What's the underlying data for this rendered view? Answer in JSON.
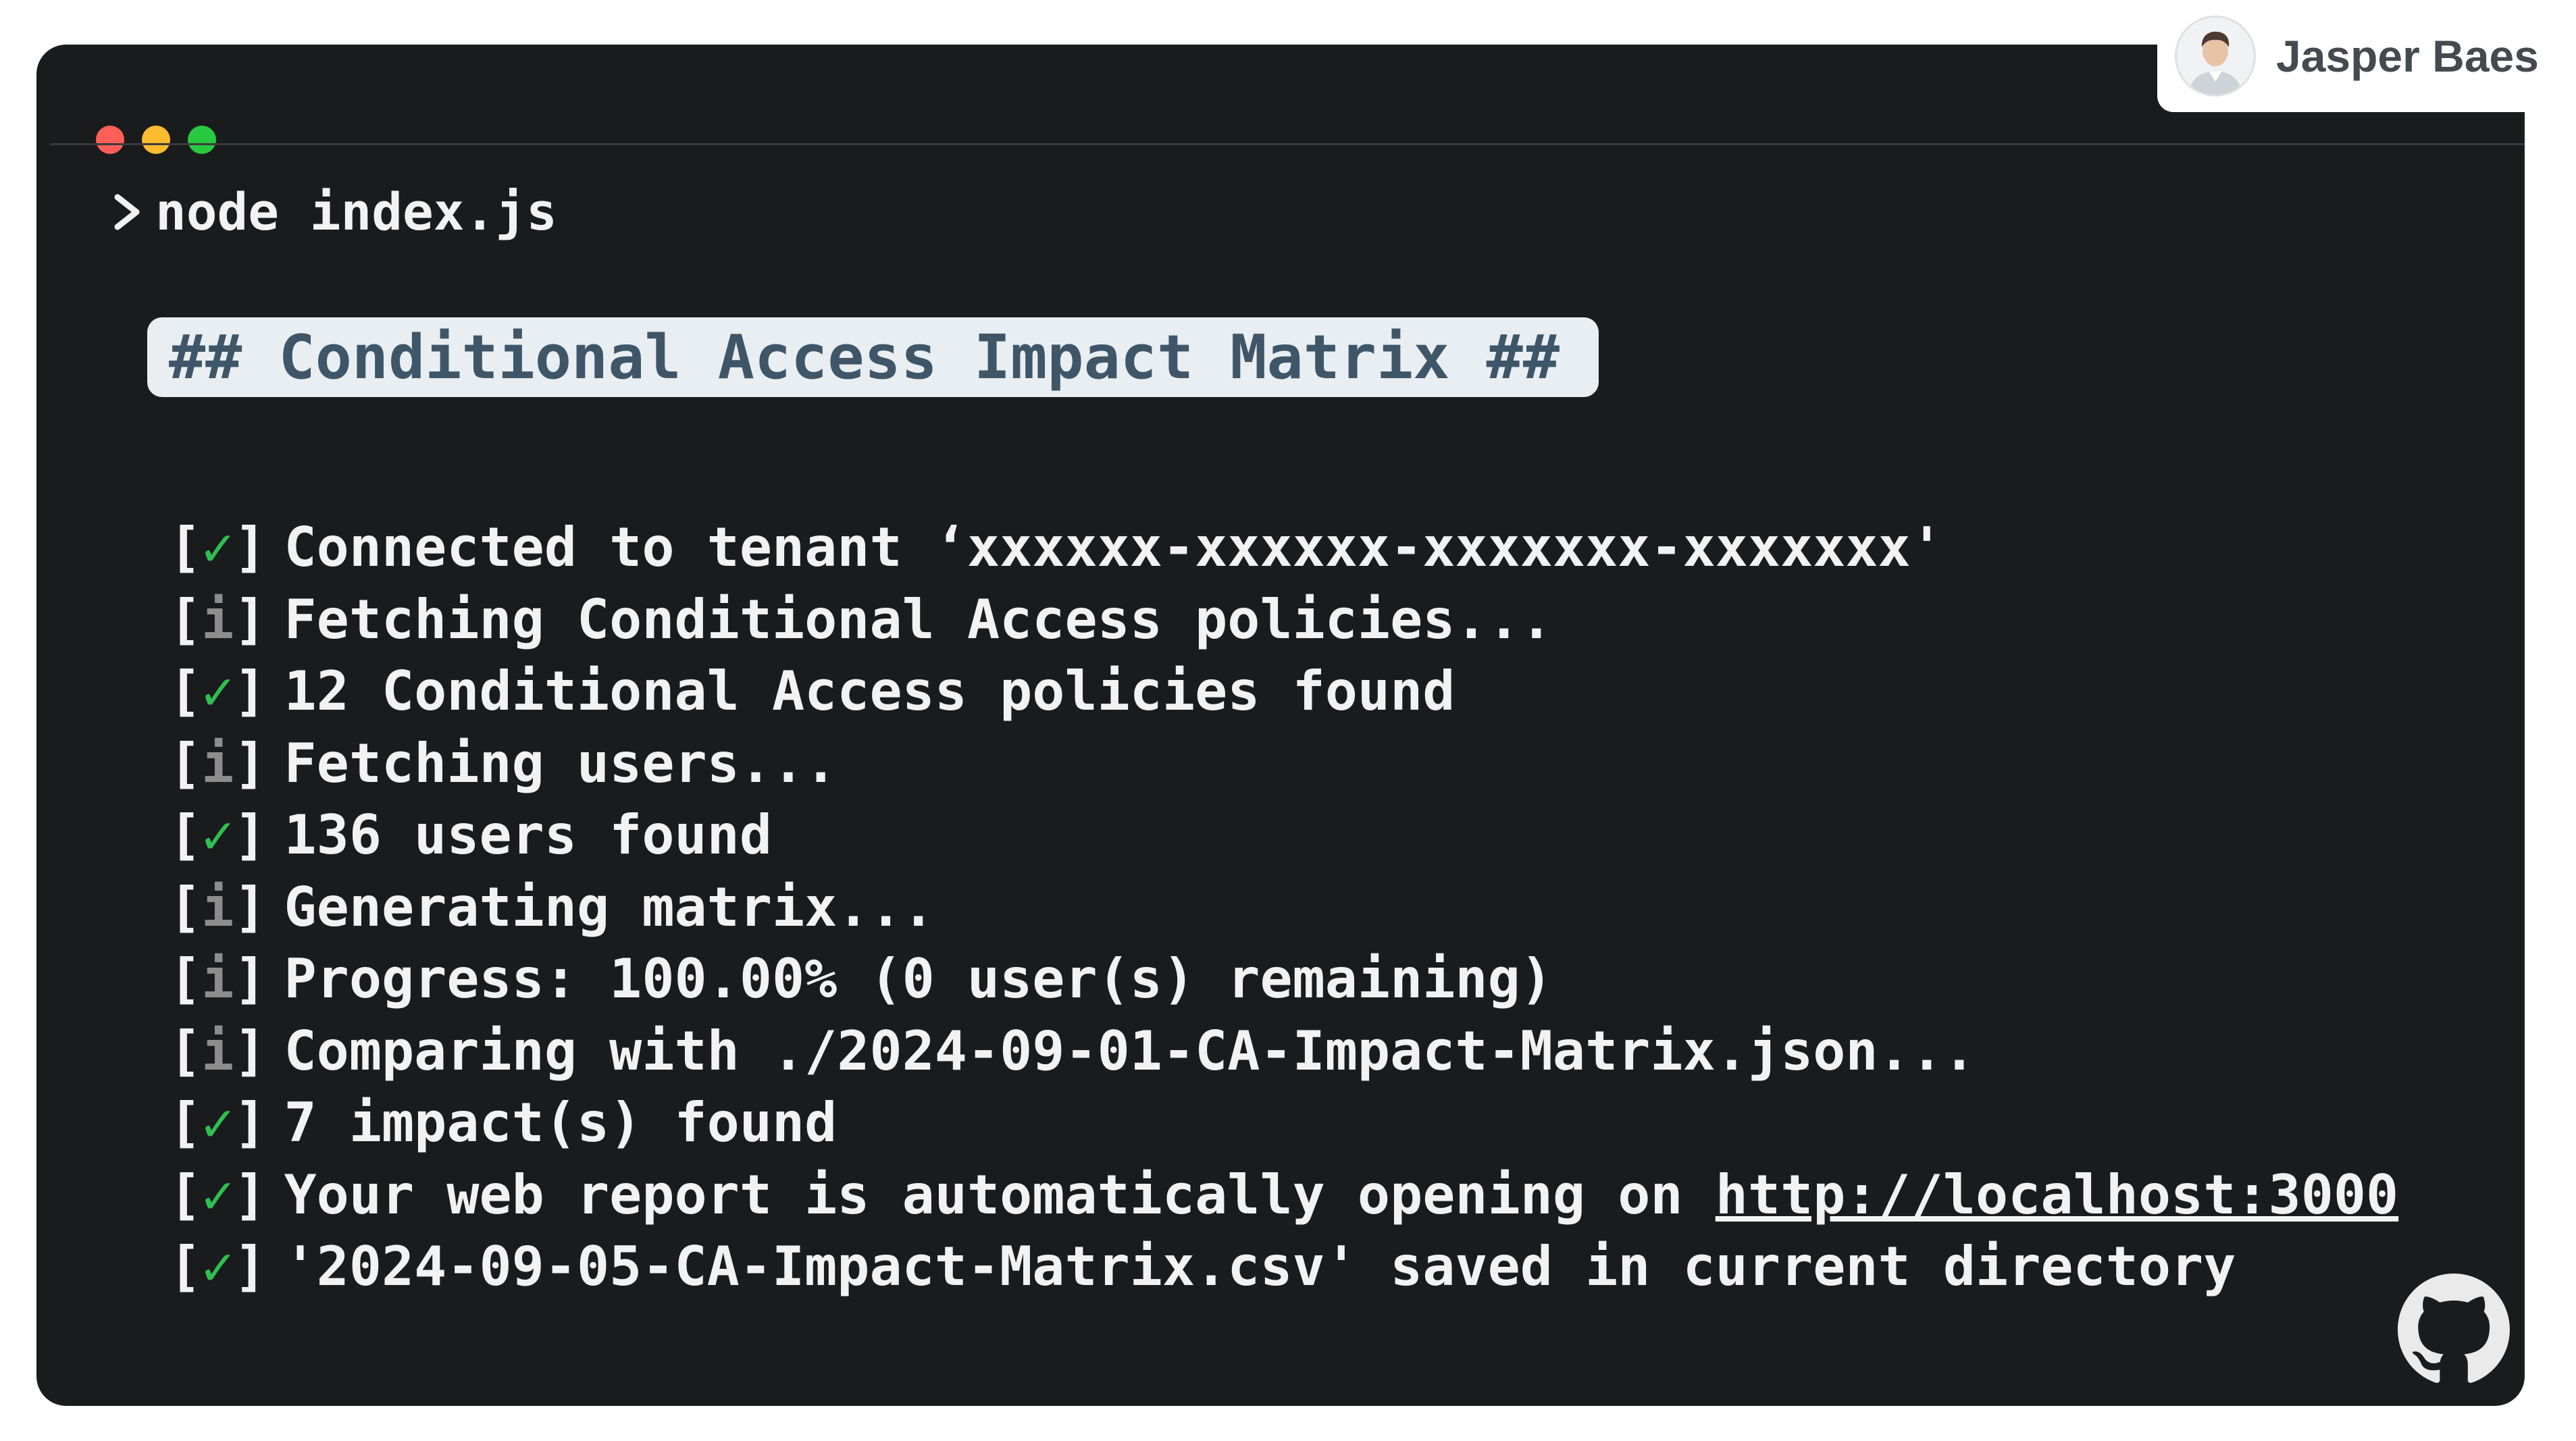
{
  "window": {
    "dot_colors": [
      "#ff5f57",
      "#febc2e",
      "#28c840"
    ]
  },
  "prompt": {
    "symbol": ">",
    "command": "node index.js"
  },
  "heading": "## Conditional Access Impact Matrix ##",
  "log_lines": [
    {
      "status": "✓",
      "type": "ok",
      "text": "Connected to tenant ‘xxxxxx-xxxxxx-xxxxxxx-xxxxxxx'"
    },
    {
      "status": "i",
      "type": "info",
      "text": "Fetching Conditional Access policies..."
    },
    {
      "status": "✓",
      "type": "ok",
      "text": "12 Conditional Access policies found"
    },
    {
      "status": "i",
      "type": "info",
      "text": "Fetching users..."
    },
    {
      "status": "✓",
      "type": "ok",
      "text": "136 users found"
    },
    {
      "status": "i",
      "type": "info",
      "text": "Generating matrix..."
    },
    {
      "status": "i",
      "type": "info",
      "text": "Progress: 100.00% (0 user(s) remaining)"
    },
    {
      "status": "i",
      "type": "info",
      "text": "Comparing with ./2024-09-01-CA-Impact-Matrix.json..."
    },
    {
      "status": "✓",
      "type": "ok",
      "text": "7 impact(s) found"
    },
    {
      "status": "✓",
      "type": "ok",
      "text": "Your web report is automatically opening on ",
      "link": "http://localhost:3000"
    },
    {
      "status": "✓",
      "type": "ok",
      "text": "'2024-09-05-CA-Impact-Matrix.csv' saved in current directory"
    }
  ],
  "author": {
    "name": "Jasper Baes",
    "avatar_icon": "person-avatar"
  },
  "footer": {
    "icon": "github-icon"
  },
  "colors": {
    "terminal_bg": "#1a1b1d",
    "ok": "#2fbf4f",
    "info": "#8d8d8d",
    "heading_bg": "#e9eef2",
    "heading_text": "#3f5668"
  }
}
